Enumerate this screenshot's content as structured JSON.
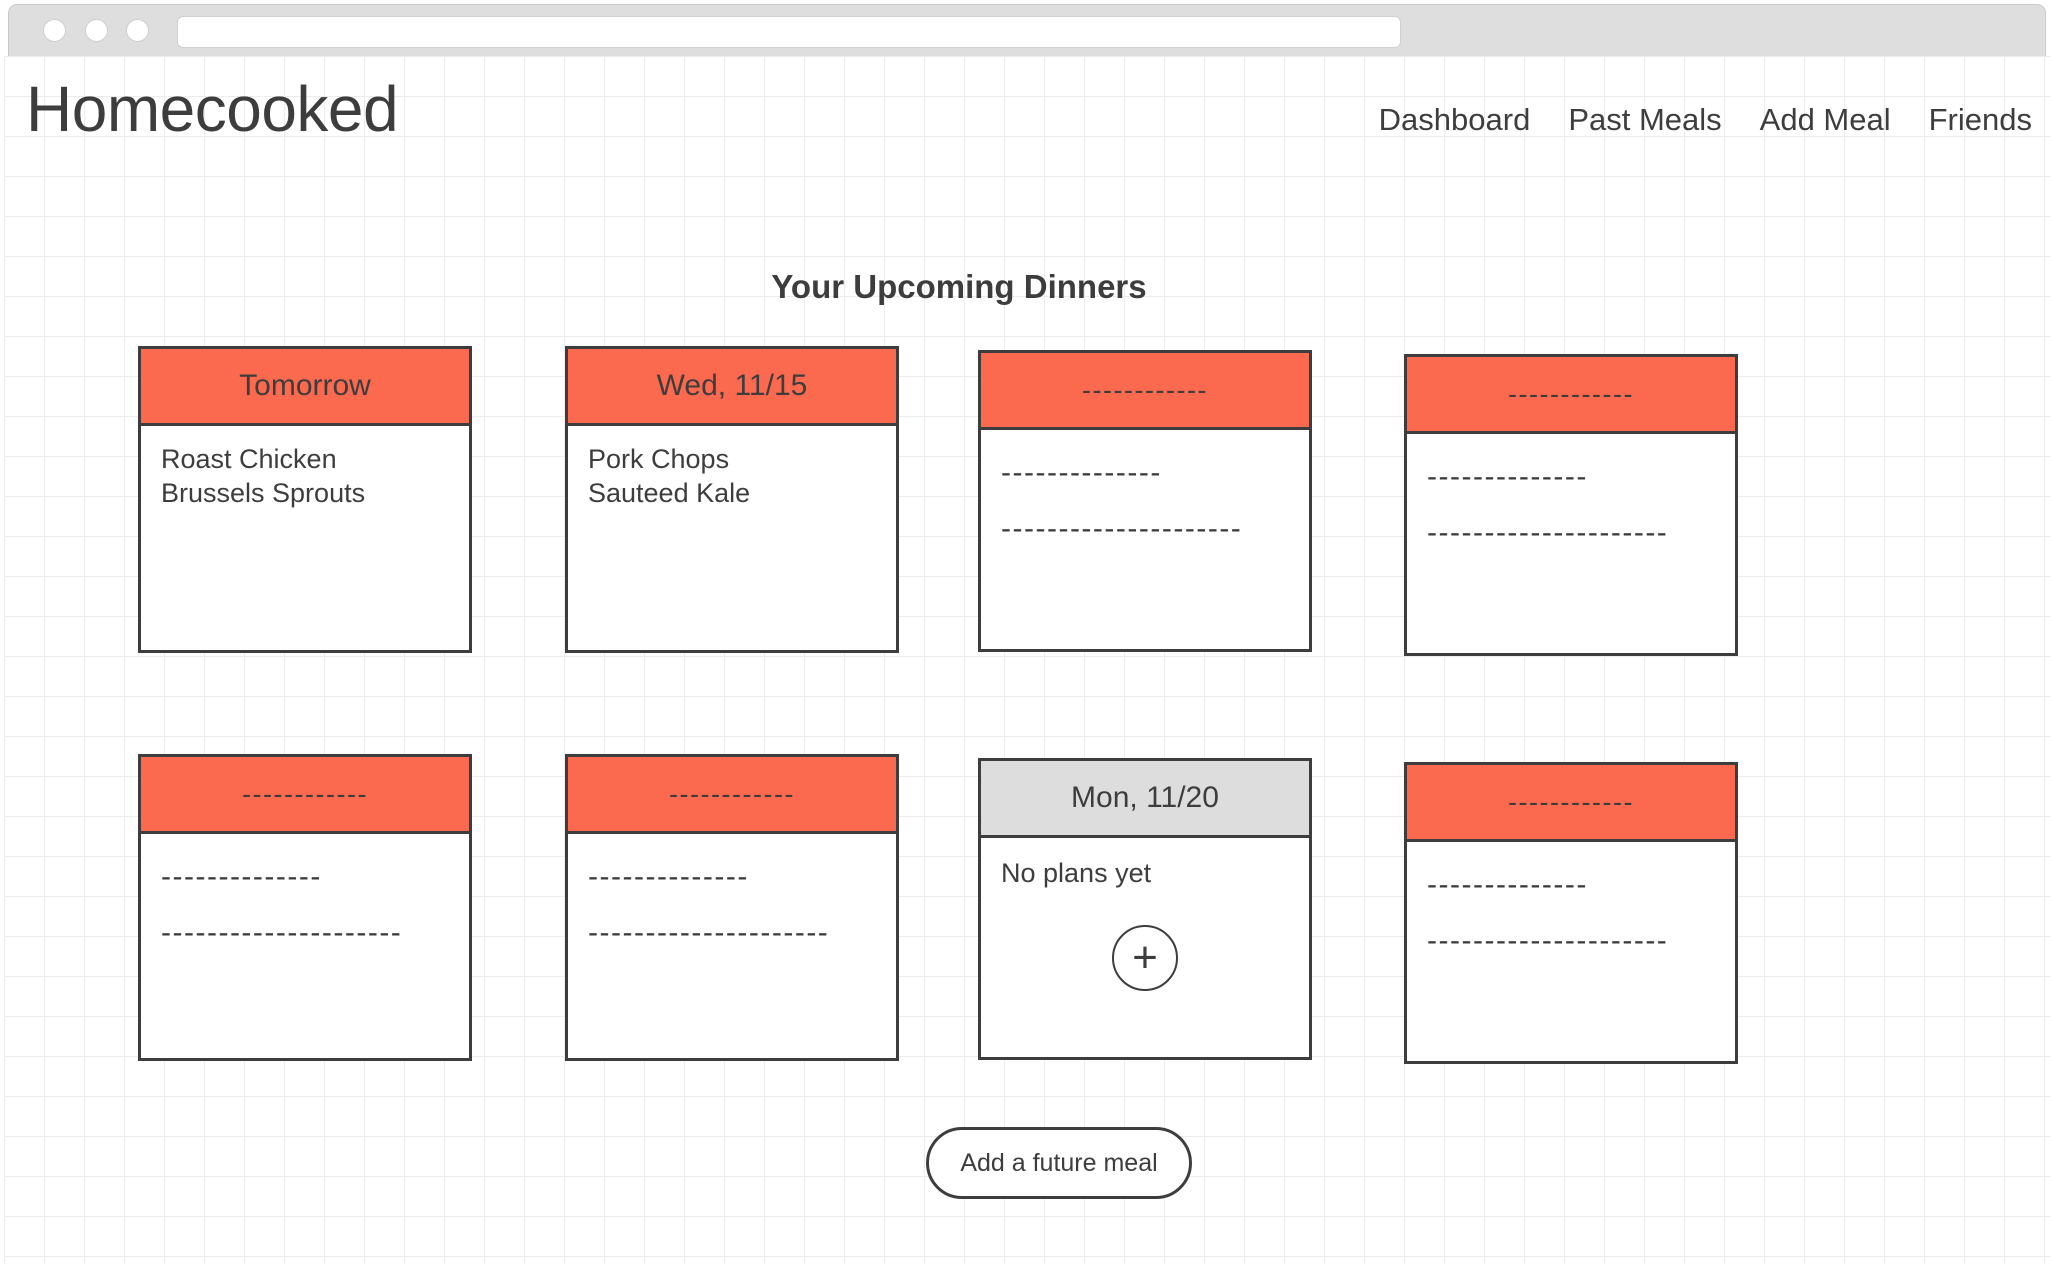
{
  "browser": {
    "window_controls": [
      "close",
      "minimize",
      "maximize"
    ],
    "address_bar_value": "",
    "address_bar_placeholder": ""
  },
  "header": {
    "brand": "Homecooked",
    "nav": [
      {
        "label": "Dashboard"
      },
      {
        "label": "Past Meals"
      },
      {
        "label": "Add Meal"
      },
      {
        "label": "Friends"
      }
    ]
  },
  "main": {
    "page_title": "Your Upcoming Dinners",
    "add_future_meal_label": "Add a future meal",
    "placeholders": {
      "header_dashes": "------------",
      "short_dashes": "--------------",
      "long_dashes": "---------------------"
    },
    "rows": [
      [
        {
          "state": "planned",
          "header_style": "filled",
          "title": "Tomorrow",
          "items": [
            "Roast Chicken",
            "Brussels Sprouts"
          ]
        },
        {
          "state": "planned",
          "header_style": "filled",
          "title": "Wed, 11/15",
          "items": [
            "Pork Chops",
            "Sauteed Kale"
          ]
        },
        {
          "state": "redacted",
          "header_style": "filled",
          "title": "------------",
          "items": [
            "--------------",
            "---------------------"
          ]
        },
        {
          "state": "redacted",
          "header_style": "filled",
          "title": "------------",
          "items": [
            "--------------",
            "---------------------"
          ]
        }
      ],
      [
        {
          "state": "redacted",
          "header_style": "filled",
          "title": "------------",
          "items": [
            "--------------",
            "---------------------"
          ]
        },
        {
          "state": "redacted",
          "header_style": "filled",
          "title": "------------",
          "items": [
            "--------------",
            "---------------------"
          ]
        },
        {
          "state": "empty",
          "header_style": "empty-state",
          "title": "Mon, 11/20",
          "empty_note": "No plans yet",
          "add_icon": "plus-icon",
          "add_glyph": "+"
        },
        {
          "state": "redacted",
          "header_style": "filled",
          "title": "------------",
          "items": [
            "--------------",
            "---------------------"
          ]
        }
      ]
    ]
  },
  "colors": {
    "accent_coral": "#fb6a4f",
    "empty_header_grey": "#dddddd",
    "border_dark": "#3d3d3d",
    "grid_line": "#ececec",
    "chrome_grey": "#dedede"
  }
}
